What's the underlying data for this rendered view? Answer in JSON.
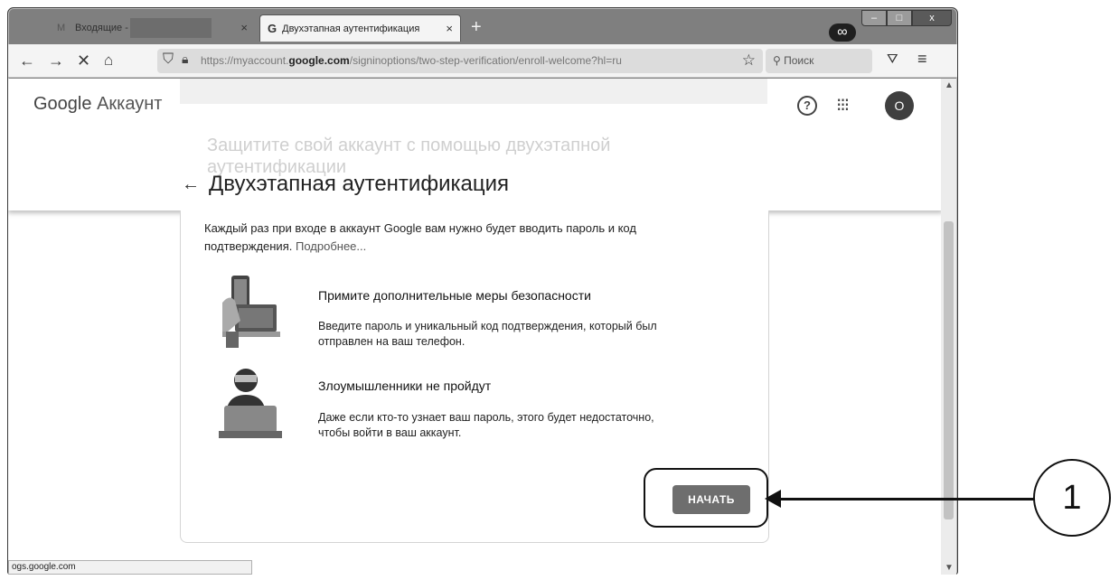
{
  "browser": {
    "tabs": [
      {
        "label": "Входящие -",
        "close": "×"
      },
      {
        "label": "Двухэтапная аутентификация",
        "close": "×"
      }
    ],
    "new_tab": "+",
    "url_prefix": "https://myaccount.",
    "url_domain": "google.com",
    "url_suffix": "/signinoptions/two-step-verification/enroll-welcome?hl=ru",
    "search_placeholder": "Поиск",
    "status_url": "ogs.google.com"
  },
  "header": {
    "logo": "Google",
    "product": "Аккаунт",
    "avatar_letter": "O",
    "ghost_title": "Защитите свой аккаунт с помощью двухэтапной аутентификации",
    "page_title": "Двухэтапная аутентификация"
  },
  "card": {
    "intro": "Каждый раз при входе в аккаунт Google вам нужно будет вводить пароль и код подтверждения.",
    "more_link": "Подробнее...",
    "features": [
      {
        "title": "Примите дополнительные меры безопасности",
        "desc": "Введите пароль и уникальный код подтверждения, который был отправлен на ваш телефон."
      },
      {
        "title": "Злоумышленники не пройдут",
        "desc": "Даже если кто-то узнает ваш пароль, этого будет недостаточно, чтобы войти в ваш аккаунт."
      }
    ],
    "start_button": "НАЧАТЬ"
  },
  "annotation": {
    "number": "1"
  },
  "icons": [
    "gmail-icon",
    "google-g-icon",
    "back-icon",
    "forward-icon",
    "stop-icon",
    "home-icon",
    "shield-icon",
    "lock-icon",
    "star-icon",
    "search-icon",
    "pocket-icon",
    "menu-icon",
    "private-mask-icon",
    "help-icon",
    "apps-grid-icon",
    "arrow-back-icon"
  ]
}
